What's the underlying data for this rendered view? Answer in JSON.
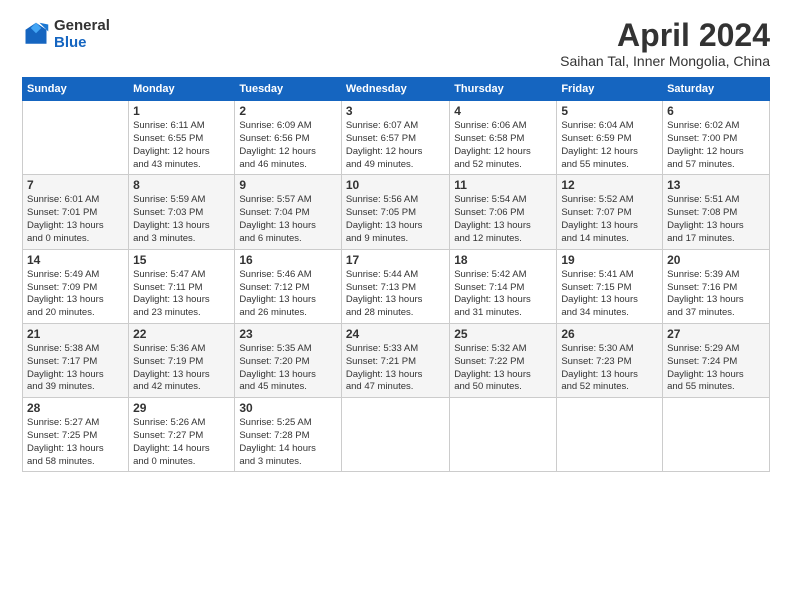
{
  "header": {
    "logo_general": "General",
    "logo_blue": "Blue",
    "title": "April 2024",
    "subtitle": "Saihan Tal, Inner Mongolia, China"
  },
  "calendar": {
    "days_of_week": [
      "Sunday",
      "Monday",
      "Tuesday",
      "Wednesday",
      "Thursday",
      "Friday",
      "Saturday"
    ],
    "weeks": [
      [
        {
          "day": "",
          "info": ""
        },
        {
          "day": "1",
          "info": "Sunrise: 6:11 AM\nSunset: 6:55 PM\nDaylight: 12 hours\nand 43 minutes."
        },
        {
          "day": "2",
          "info": "Sunrise: 6:09 AM\nSunset: 6:56 PM\nDaylight: 12 hours\nand 46 minutes."
        },
        {
          "day": "3",
          "info": "Sunrise: 6:07 AM\nSunset: 6:57 PM\nDaylight: 12 hours\nand 49 minutes."
        },
        {
          "day": "4",
          "info": "Sunrise: 6:06 AM\nSunset: 6:58 PM\nDaylight: 12 hours\nand 52 minutes."
        },
        {
          "day": "5",
          "info": "Sunrise: 6:04 AM\nSunset: 6:59 PM\nDaylight: 12 hours\nand 55 minutes."
        },
        {
          "day": "6",
          "info": "Sunrise: 6:02 AM\nSunset: 7:00 PM\nDaylight: 12 hours\nand 57 minutes."
        }
      ],
      [
        {
          "day": "7",
          "info": "Sunrise: 6:01 AM\nSunset: 7:01 PM\nDaylight: 13 hours\nand 0 minutes."
        },
        {
          "day": "8",
          "info": "Sunrise: 5:59 AM\nSunset: 7:03 PM\nDaylight: 13 hours\nand 3 minutes."
        },
        {
          "day": "9",
          "info": "Sunrise: 5:57 AM\nSunset: 7:04 PM\nDaylight: 13 hours\nand 6 minutes."
        },
        {
          "day": "10",
          "info": "Sunrise: 5:56 AM\nSunset: 7:05 PM\nDaylight: 13 hours\nand 9 minutes."
        },
        {
          "day": "11",
          "info": "Sunrise: 5:54 AM\nSunset: 7:06 PM\nDaylight: 13 hours\nand 12 minutes."
        },
        {
          "day": "12",
          "info": "Sunrise: 5:52 AM\nSunset: 7:07 PM\nDaylight: 13 hours\nand 14 minutes."
        },
        {
          "day": "13",
          "info": "Sunrise: 5:51 AM\nSunset: 7:08 PM\nDaylight: 13 hours\nand 17 minutes."
        }
      ],
      [
        {
          "day": "14",
          "info": "Sunrise: 5:49 AM\nSunset: 7:09 PM\nDaylight: 13 hours\nand 20 minutes."
        },
        {
          "day": "15",
          "info": "Sunrise: 5:47 AM\nSunset: 7:11 PM\nDaylight: 13 hours\nand 23 minutes."
        },
        {
          "day": "16",
          "info": "Sunrise: 5:46 AM\nSunset: 7:12 PM\nDaylight: 13 hours\nand 26 minutes."
        },
        {
          "day": "17",
          "info": "Sunrise: 5:44 AM\nSunset: 7:13 PM\nDaylight: 13 hours\nand 28 minutes."
        },
        {
          "day": "18",
          "info": "Sunrise: 5:42 AM\nSunset: 7:14 PM\nDaylight: 13 hours\nand 31 minutes."
        },
        {
          "day": "19",
          "info": "Sunrise: 5:41 AM\nSunset: 7:15 PM\nDaylight: 13 hours\nand 34 minutes."
        },
        {
          "day": "20",
          "info": "Sunrise: 5:39 AM\nSunset: 7:16 PM\nDaylight: 13 hours\nand 37 minutes."
        }
      ],
      [
        {
          "day": "21",
          "info": "Sunrise: 5:38 AM\nSunset: 7:17 PM\nDaylight: 13 hours\nand 39 minutes."
        },
        {
          "day": "22",
          "info": "Sunrise: 5:36 AM\nSunset: 7:19 PM\nDaylight: 13 hours\nand 42 minutes."
        },
        {
          "day": "23",
          "info": "Sunrise: 5:35 AM\nSunset: 7:20 PM\nDaylight: 13 hours\nand 45 minutes."
        },
        {
          "day": "24",
          "info": "Sunrise: 5:33 AM\nSunset: 7:21 PM\nDaylight: 13 hours\nand 47 minutes."
        },
        {
          "day": "25",
          "info": "Sunrise: 5:32 AM\nSunset: 7:22 PM\nDaylight: 13 hours\nand 50 minutes."
        },
        {
          "day": "26",
          "info": "Sunrise: 5:30 AM\nSunset: 7:23 PM\nDaylight: 13 hours\nand 52 minutes."
        },
        {
          "day": "27",
          "info": "Sunrise: 5:29 AM\nSunset: 7:24 PM\nDaylight: 13 hours\nand 55 minutes."
        }
      ],
      [
        {
          "day": "28",
          "info": "Sunrise: 5:27 AM\nSunset: 7:25 PM\nDaylight: 13 hours\nand 58 minutes."
        },
        {
          "day": "29",
          "info": "Sunrise: 5:26 AM\nSunset: 7:27 PM\nDaylight: 14 hours\nand 0 minutes."
        },
        {
          "day": "30",
          "info": "Sunrise: 5:25 AM\nSunset: 7:28 PM\nDaylight: 14 hours\nand 3 minutes."
        },
        {
          "day": "",
          "info": ""
        },
        {
          "day": "",
          "info": ""
        },
        {
          "day": "",
          "info": ""
        },
        {
          "day": "",
          "info": ""
        }
      ]
    ]
  }
}
